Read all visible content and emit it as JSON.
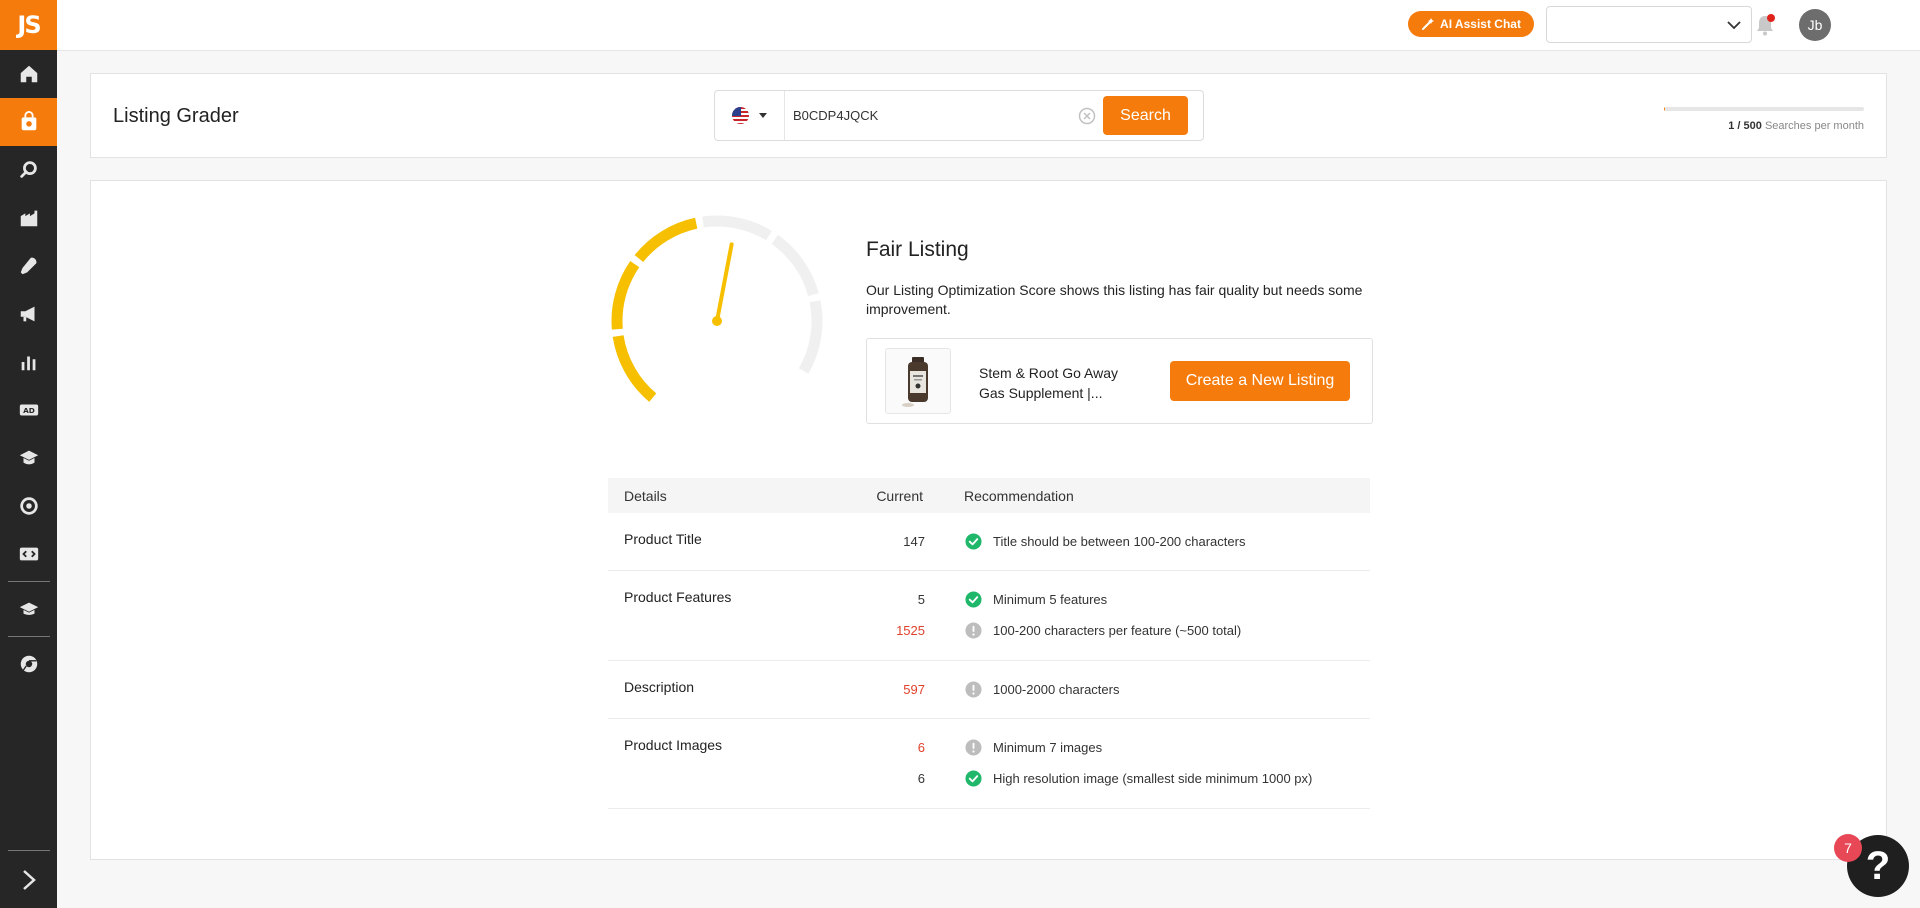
{
  "app": {
    "logo_text": "JS"
  },
  "sidebar": {
    "items": [
      {
        "name": "home-icon"
      },
      {
        "name": "product-research-icon",
        "active": true
      },
      {
        "name": "keyword-search-icon"
      },
      {
        "name": "supplier-icon"
      },
      {
        "name": "tools-icon"
      },
      {
        "name": "marketing-icon"
      },
      {
        "name": "analytics-icon"
      },
      {
        "name": "ad-icon"
      },
      {
        "name": "academy-hat-icon"
      },
      {
        "name": "money-icon"
      },
      {
        "name": "code-icon"
      },
      {
        "name": "learn-icon"
      },
      {
        "name": "chrome-extension-icon"
      }
    ]
  },
  "header": {
    "ai_assist_label": "AI Assist Chat",
    "marketplace_value": "",
    "avatar_initials": "Jb"
  },
  "search": {
    "page_title": "Listing Grader",
    "query": "B0CDP4JQCK",
    "button_label": "Search",
    "usage_count": "1 / 500",
    "usage_label": "Searches per month",
    "usage_fraction": 0.002
  },
  "result": {
    "verdict": "Fair Listing",
    "description": "Our Listing Optimization Score shows this listing has fair quality but needs some improvement.",
    "score_fraction": 0.58,
    "product_name": "Stem & Root Go Away Gas Supplement |...",
    "create_button_label": "Create a New Listing"
  },
  "table": {
    "headers": {
      "details": "Details",
      "current": "Current",
      "recommendation": "Recommendation"
    },
    "rows": [
      {
        "label": "Product Title",
        "lines": [
          {
            "value": "147",
            "status": "ok",
            "recommendation": "Title should be between 100-200 characters"
          }
        ]
      },
      {
        "label": "Product Features",
        "lines": [
          {
            "value": "5",
            "status": "ok",
            "recommendation": "Minimum 5 features"
          },
          {
            "value": "1525",
            "status": "warn",
            "recommendation": "100-200 characters per feature (~500 total)"
          }
        ]
      },
      {
        "label": "Description",
        "lines": [
          {
            "value": "597",
            "status": "warn",
            "recommendation": "1000-2000 characters"
          }
        ]
      },
      {
        "label": "Product Images",
        "lines": [
          {
            "value": "6",
            "status": "warn",
            "recommendation": "Minimum 7 images"
          },
          {
            "value": "6",
            "status": "ok",
            "recommendation": "High resolution image (smallest side minimum 1000 px)"
          }
        ]
      }
    ]
  },
  "help": {
    "label": "?",
    "badge_count": "7"
  },
  "colors": {
    "accent": "#f47b0c",
    "gauge": "#f6c000",
    "ok": "#1fb76a",
    "warn": "#e0422b",
    "neutral": "#bdbdbd"
  }
}
